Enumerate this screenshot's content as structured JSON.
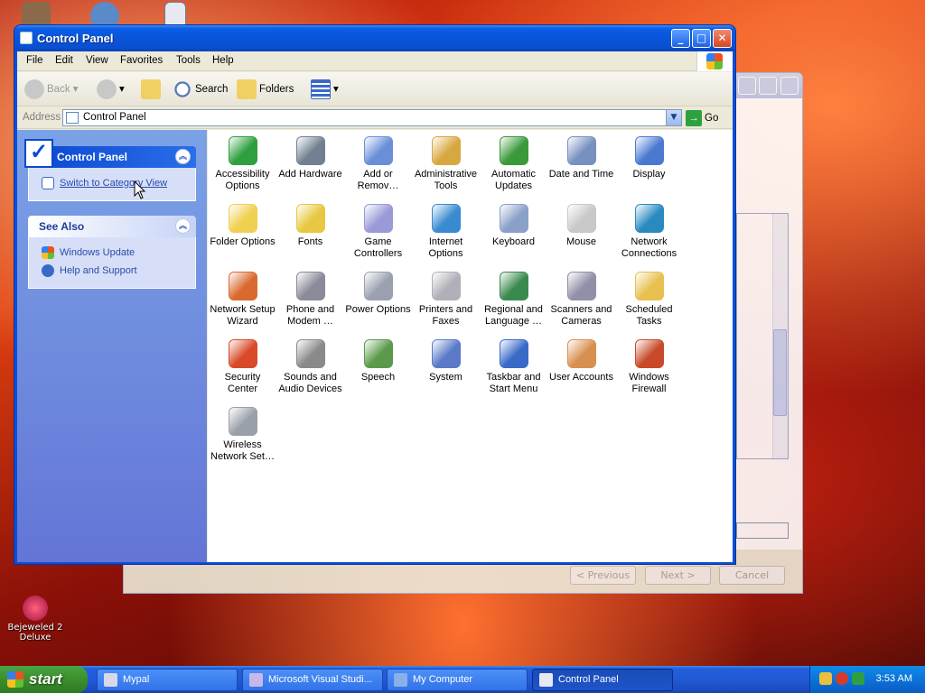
{
  "window": {
    "title": "Control Panel",
    "buttons": {
      "minimize": "_",
      "maximize": "□",
      "close": "✕"
    }
  },
  "menu": [
    "File",
    "Edit",
    "View",
    "Favorites",
    "Tools",
    "Help"
  ],
  "toolbar": {
    "back": "Back",
    "search": "Search",
    "folders": "Folders"
  },
  "address": {
    "label": "Address",
    "value": "Control Panel",
    "go": "Go"
  },
  "sidebar": {
    "panel1": {
      "title": "Control Panel",
      "link": "Switch to Category View"
    },
    "panel2": {
      "title": "See Also",
      "links": [
        "Windows Update",
        "Help and Support"
      ]
    }
  },
  "items": [
    {
      "l1": "Accessibility",
      "l2": "Options",
      "icon": "accessibility-icon",
      "color": "#2fa040"
    },
    {
      "l1": "Add Hardware",
      "l2": "",
      "icon": "add-hardware-icon",
      "color": "#708090"
    },
    {
      "l1": "Add or",
      "l2": "Remov…",
      "icon": "add-remove-programs-icon",
      "color": "#6a8fd8"
    },
    {
      "l1": "Administrative",
      "l2": "Tools",
      "icon": "administrative-tools-icon",
      "color": "#d8a840"
    },
    {
      "l1": "Automatic",
      "l2": "Updates",
      "icon": "automatic-updates-icon",
      "color": "#3a9a3a"
    },
    {
      "l1": "Date and Time",
      "l2": "",
      "icon": "date-time-icon",
      "color": "#7890c0"
    },
    {
      "l1": "Display",
      "l2": "",
      "icon": "display-icon",
      "color": "#4a7ad0"
    },
    {
      "l1": "Folder Options",
      "l2": "",
      "icon": "folder-options-icon",
      "color": "#f0d050"
    },
    {
      "l1": "Fonts",
      "l2": "",
      "icon": "fonts-icon",
      "color": "#e8c840"
    },
    {
      "l1": "Game",
      "l2": "Controllers",
      "icon": "game-controllers-icon",
      "color": "#9a9ad8"
    },
    {
      "l1": "Internet",
      "l2": "Options",
      "icon": "internet-options-icon",
      "color": "#3a8ad0"
    },
    {
      "l1": "Keyboard",
      "l2": "",
      "icon": "keyboard-icon",
      "color": "#8aa0c8"
    },
    {
      "l1": "Mouse",
      "l2": "",
      "icon": "mouse-icon",
      "color": "#c8c8c8"
    },
    {
      "l1": "Network",
      "l2": "Connections",
      "icon": "network-connections-icon",
      "color": "#2a8ac0"
    },
    {
      "l1": "Network Setup",
      "l2": "Wizard",
      "icon": "network-setup-wizard-icon",
      "color": "#d86a30"
    },
    {
      "l1": "Phone and",
      "l2": "Modem …",
      "icon": "phone-modem-icon",
      "color": "#8a8a9a"
    },
    {
      "l1": "Power Options",
      "l2": "",
      "icon": "power-options-icon",
      "color": "#9aa0b0"
    },
    {
      "l1": "Printers and",
      "l2": "Faxes",
      "icon": "printers-faxes-icon",
      "color": "#b0b0b8"
    },
    {
      "l1": "Regional and",
      "l2": "Language …",
      "icon": "regional-language-icon",
      "color": "#3a8a50"
    },
    {
      "l1": "Scanners and",
      "l2": "Cameras",
      "icon": "scanners-cameras-icon",
      "color": "#9090a8"
    },
    {
      "l1": "Scheduled",
      "l2": "Tasks",
      "icon": "scheduled-tasks-icon",
      "color": "#e8c050"
    },
    {
      "l1": "Security",
      "l2": "Center",
      "icon": "security-center-icon",
      "color": "#d84a2a"
    },
    {
      "l1": "Sounds and",
      "l2": "Audio Devices",
      "icon": "sounds-audio-icon",
      "color": "#8a8a8a"
    },
    {
      "l1": "Speech",
      "l2": "",
      "icon": "speech-icon",
      "color": "#5a9a4a"
    },
    {
      "l1": "System",
      "l2": "",
      "icon": "system-icon",
      "color": "#5a7ac8"
    },
    {
      "l1": "Taskbar and",
      "l2": "Start Menu",
      "icon": "taskbar-start-menu-icon",
      "color": "#3a6ac8"
    },
    {
      "l1": "User Accounts",
      "l2": "",
      "icon": "user-accounts-icon",
      "color": "#d89050"
    },
    {
      "l1": "Windows",
      "l2": "Firewall",
      "icon": "windows-firewall-icon",
      "color": "#c84a2a"
    },
    {
      "l1": "Wireless",
      "l2": "Network Set…",
      "icon": "wireless-network-icon",
      "color": "#9aa0a8"
    }
  ],
  "wizard": {
    "prev": "< Previous",
    "next": "Next >",
    "cancel": "Cancel"
  },
  "desktop": {
    "bejeweled": {
      "l1": "Bejeweled 2",
      "l2": "Deluxe"
    }
  },
  "taskbar": {
    "start": "start",
    "tasks": [
      "Mypal",
      "Microsoft Visual Studi...",
      "My Computer",
      "Control Panel"
    ],
    "clock": "3:53 AM"
  }
}
